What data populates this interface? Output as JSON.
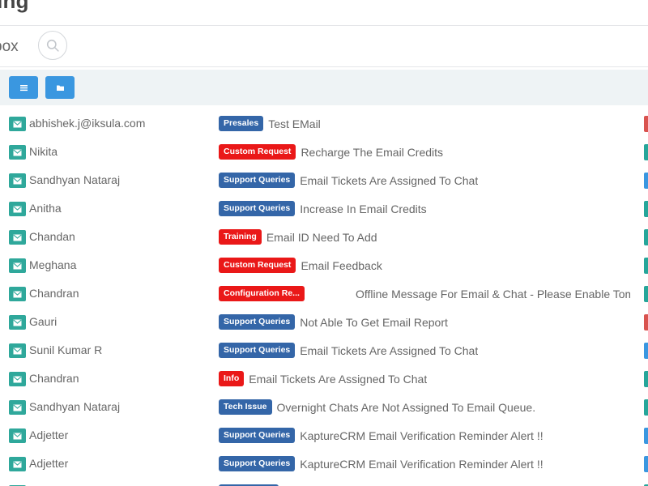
{
  "header": {
    "title": "ding"
  },
  "search": {
    "label": "box",
    "icon": "search-icon"
  },
  "toolbar": {
    "buttons": [
      {
        "icon": "list-icon"
      },
      {
        "icon": "folder-icon"
      }
    ]
  },
  "colors": {
    "mail_icon": "#2fa89b",
    "tag_blue": "#3466a8",
    "tag_red": "#ea1818",
    "toolbar_button": "#3a97e0"
  },
  "rows": [
    {
      "sender": "abhishek.j@iksula.com",
      "tag": "Presales",
      "tag_color": "blue",
      "subject": "Test EMail",
      "edge_color": "#d9534f"
    },
    {
      "sender": "Nikita",
      "tag": "Custom Request",
      "tag_color": "red",
      "subject": "Recharge The Email Credits",
      "edge_color": "#26a69a"
    },
    {
      "sender": "Sandhyan Nataraj",
      "tag": "Support Queries",
      "tag_color": "blue",
      "subject": "Email Tickets Are Assigned To Chat",
      "edge_color": "#3a97e0"
    },
    {
      "sender": "Anitha",
      "tag": "Support Queries",
      "tag_color": "blue",
      "subject": "Increase In Email Credits",
      "edge_color": "#26a69a"
    },
    {
      "sender": "Chandan",
      "tag": "Training",
      "tag_color": "red",
      "subject": "Email ID Need To Add",
      "edge_color": "#26a69a"
    },
    {
      "sender": "Meghana",
      "tag": "Custom Request",
      "tag_color": "red",
      "subject": "Email Feedback",
      "edge_color": "#26a69a"
    },
    {
      "sender": "Chandran",
      "tag": "Configuration Re...",
      "tag_color": "red",
      "subject": "Offline Message For Email & Chat - Please Enable Tom...",
      "edge_color": "#26a69a"
    },
    {
      "sender": "Gauri",
      "tag": "Support Queries",
      "tag_color": "blue",
      "subject": "Not Able To Get Email Report",
      "edge_color": "#d9534f"
    },
    {
      "sender": "Sunil Kumar R",
      "tag": "Support Queries",
      "tag_color": "blue",
      "subject": "Email Tickets Are Assigned To Chat",
      "edge_color": "#3a97e0"
    },
    {
      "sender": "Chandran",
      "tag": "Info",
      "tag_color": "red",
      "subject": "Email Tickets Are Assigned To Chat",
      "edge_color": "#26a69a"
    },
    {
      "sender": "Sandhyan Nataraj",
      "tag": "Tech Issue",
      "tag_color": "blue",
      "subject": "Overnight Chats Are Not Assigned To Email Queue.",
      "edge_color": "#26a69a"
    },
    {
      "sender": "Adjetter",
      "tag": "Support Queries",
      "tag_color": "blue",
      "subject": "KaptureCRM Email Verification Reminder Alert !!",
      "edge_color": "#3a97e0"
    },
    {
      "sender": "Adjetter",
      "tag": "Support Queries",
      "tag_color": "blue",
      "subject": "KaptureCRM Email Verification Reminder Alert !!",
      "edge_color": "#3a97e0"
    },
    {
      "sender": "",
      "tag": "",
      "tag_color": "blue",
      "subject": "",
      "edge_color": "#26a69a"
    }
  ]
}
